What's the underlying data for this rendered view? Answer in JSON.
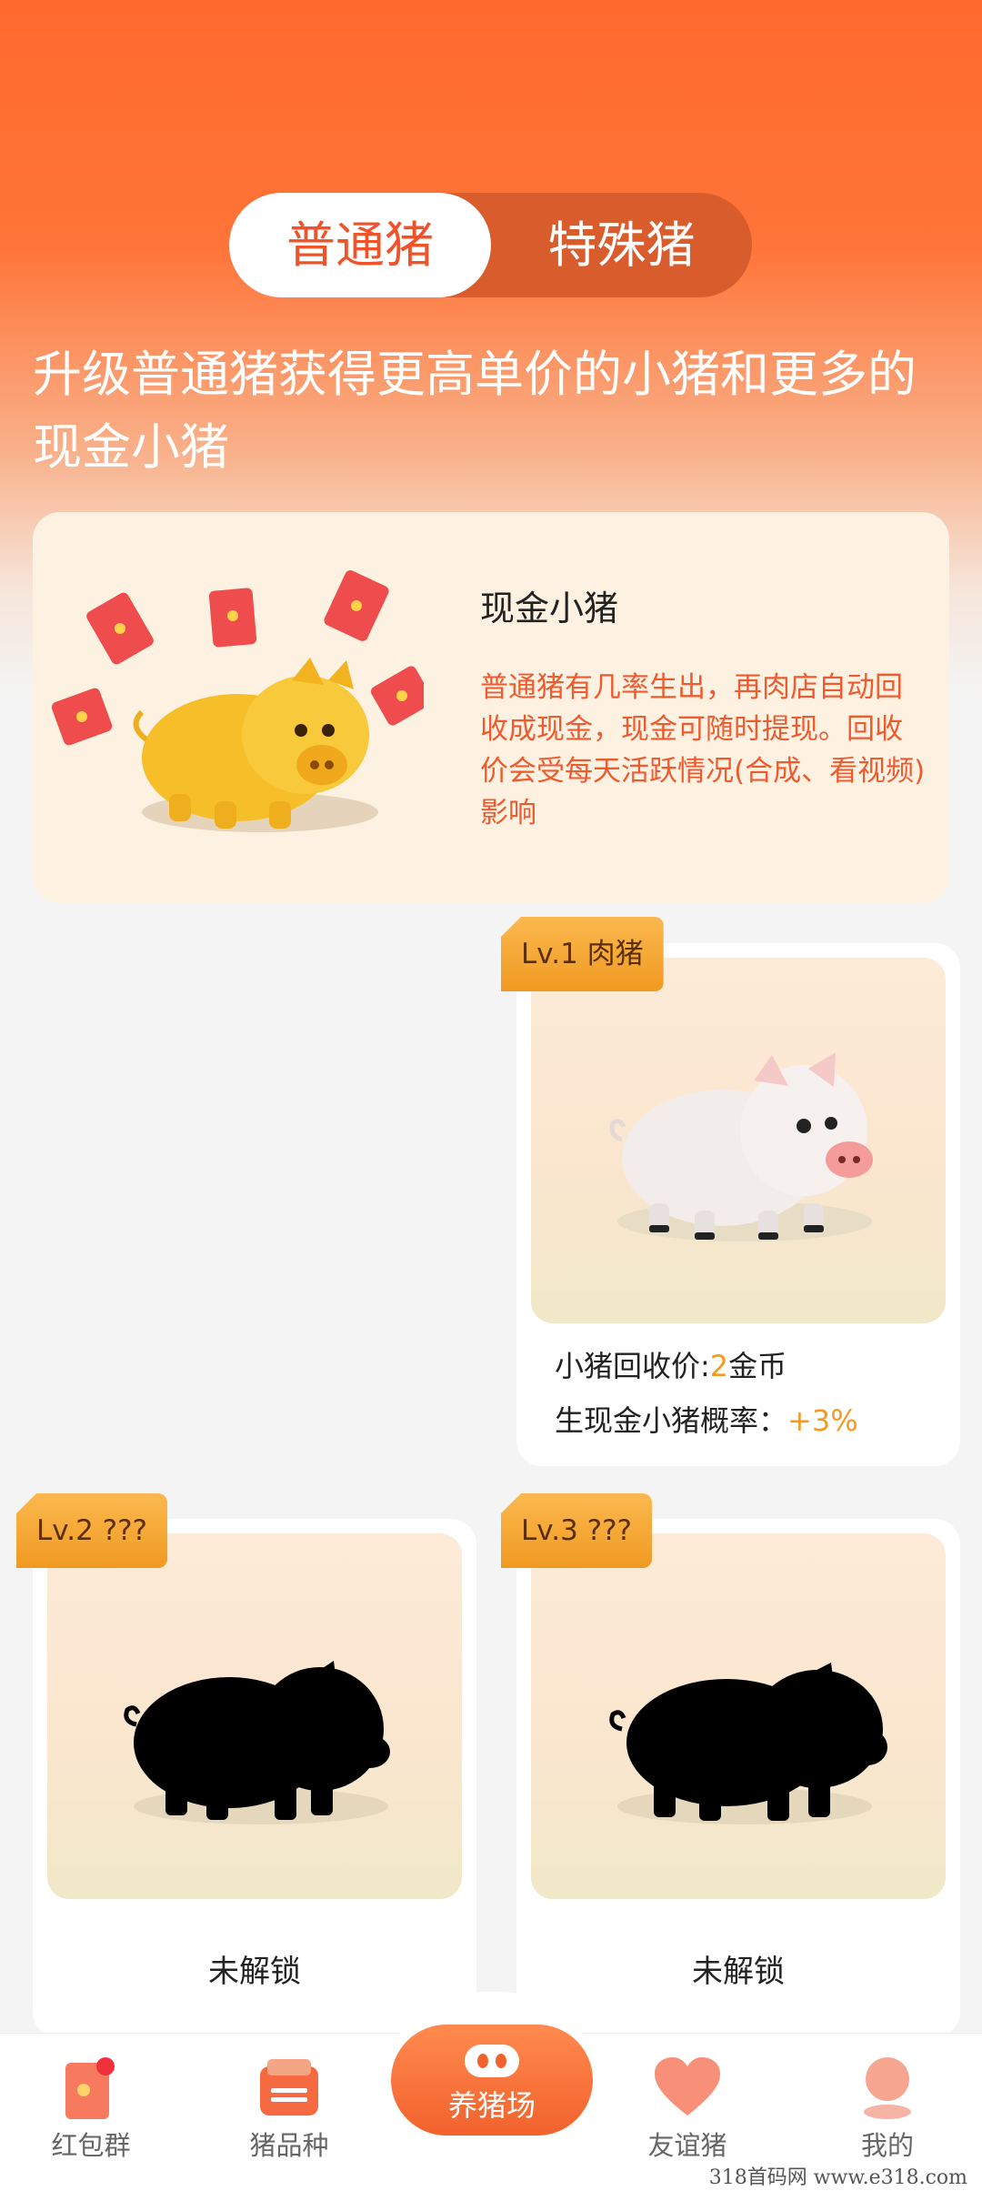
{
  "tabs": {
    "active": "普通猪",
    "other": "特殊猪"
  },
  "headline": "升级普通猪获得更高单价的小猪和更多的现金小猪",
  "info_card": {
    "title": "现金小猪",
    "description": "普通猪有几率生出，再肉店自动回收成现金，现金可随时提现。回收价会受每天活跃情况(合成、看视频)影响"
  },
  "pigs": [
    {
      "badge": "Lv.1 肉猪",
      "price_label": "小猪回收价:",
      "price_value": "2",
      "price_unit": "金币",
      "rate_label": "生现金小猪概率：",
      "rate_value": "+3%"
    },
    {
      "badge": "Lv.2 ???",
      "status": "未解锁"
    },
    {
      "badge": "Lv.3 ???",
      "status": "未解锁"
    }
  ],
  "nav": {
    "items": [
      {
        "label": "红包群",
        "icon": "red-packet-icon"
      },
      {
        "label": "猪品种",
        "icon": "wallet-icon"
      },
      {
        "label": "养猪场",
        "icon": "pig-nose-icon"
      },
      {
        "label": "友谊猪",
        "icon": "heart-icon"
      },
      {
        "label": "我的",
        "icon": "profile-icon"
      }
    ]
  },
  "watermark": "318首码网  www.e318.com",
  "colors": {
    "accent": "#f0532a",
    "badge": "#f5a83a",
    "highlight": "#f59a1f"
  }
}
